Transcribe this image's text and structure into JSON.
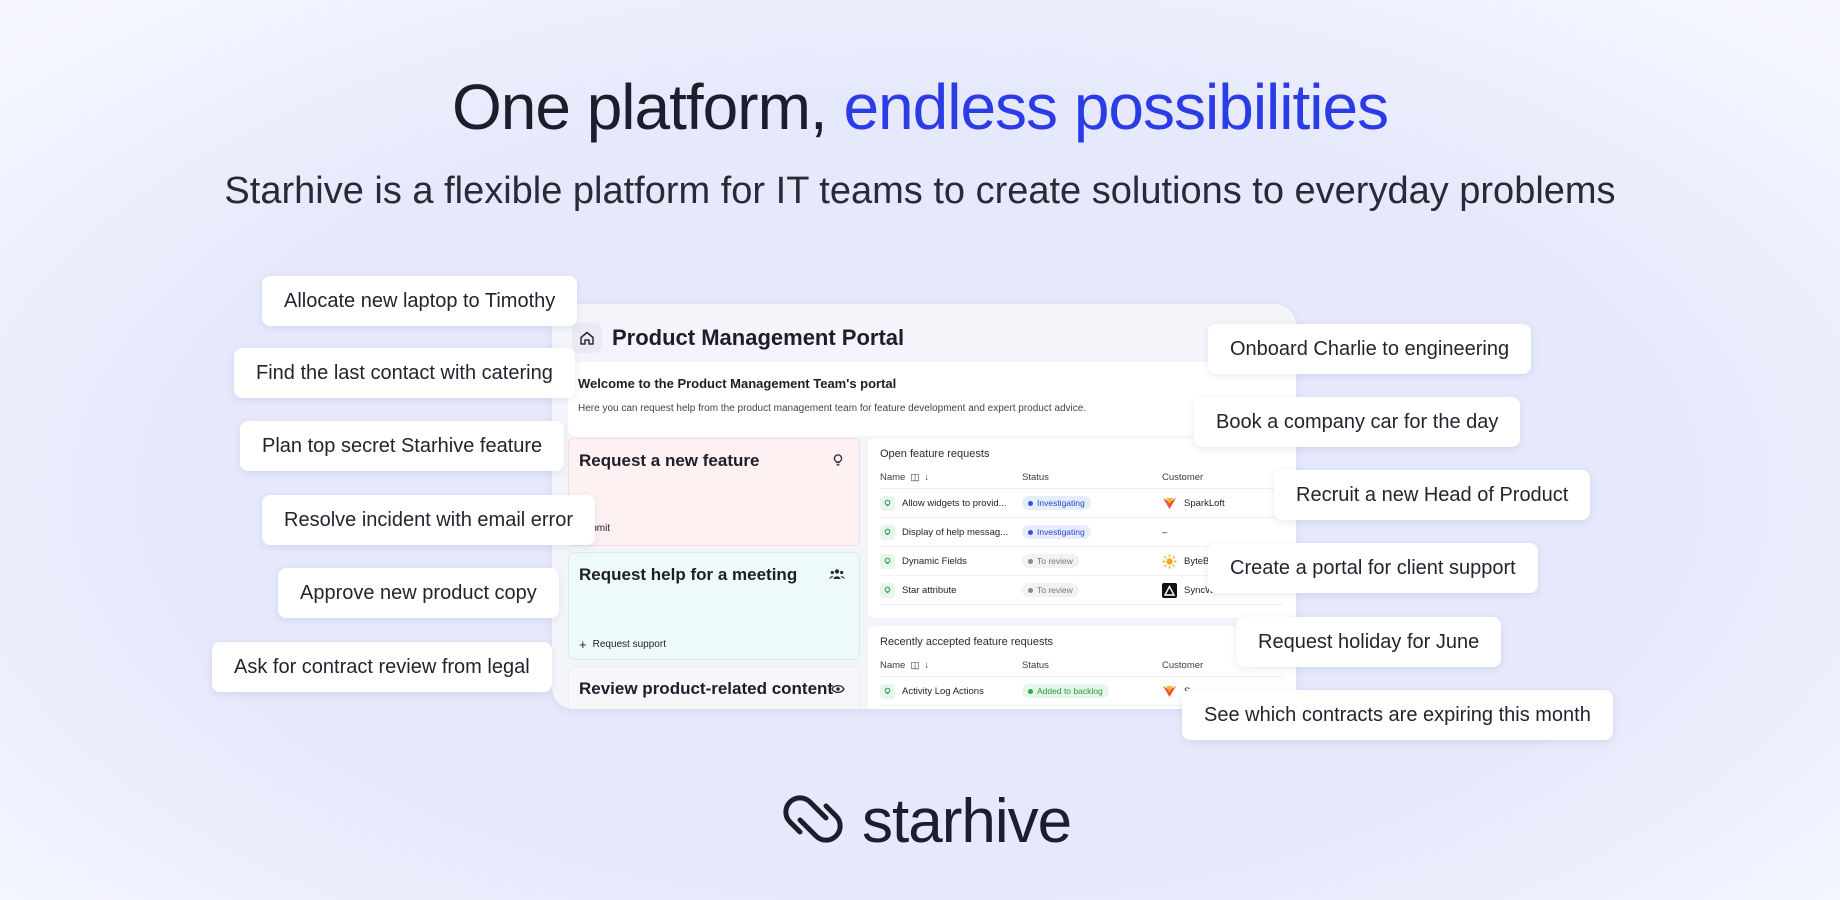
{
  "hero": {
    "title_main": "One platform, ",
    "title_accent": "endless possibilities",
    "subtitle": "Starhive is a flexible platform for IT teams to create solutions to everyday problems"
  },
  "portal": {
    "title": "Product Management Portal",
    "welcome_title": "Welcome to the Product Management Team's portal",
    "welcome_text": "Here you can request help from the product management team for feature development and expert product advice.",
    "request_cards": [
      {
        "title": "Request a new feature",
        "action": "Submit",
        "icon": "lightbulb-icon"
      },
      {
        "title": "Request help for a meeting",
        "action": "Request support",
        "icon": "people-icon"
      },
      {
        "title": "Review product-related content",
        "action": "",
        "icon": "eye-icon"
      }
    ],
    "open_requests": {
      "title": "Open feature requests",
      "headers": {
        "name": "Name",
        "status": "Status",
        "customer": "Customer"
      },
      "rows": [
        {
          "name": "Allow widgets to provid...",
          "status": "Investigating",
          "customer": "SparkLoft"
        },
        {
          "name": "Display of help messag...",
          "status": "Investigating",
          "customer": "–"
        },
        {
          "name": "Dynamic Fields",
          "status": "To review",
          "customer": "ByteBl"
        },
        {
          "name": "Star attribute",
          "status": "To review",
          "customer": "SyncWave"
        }
      ]
    },
    "accepted_requests": {
      "title": "Recently accepted feature requests",
      "headers": {
        "name": "Name",
        "status": "Status",
        "customer": "Customer"
      },
      "rows": [
        {
          "name": "Activity Log Actions",
          "status": "Added to backlog",
          "customer": "S"
        }
      ]
    }
  },
  "pills_left": [
    "Allocate new laptop to Timothy",
    "Find the last contact with catering",
    "Plan top secret Starhive feature",
    "Resolve incident with email error",
    "Approve new product copy",
    "Ask for contract review from legal"
  ],
  "pills_right": [
    "Onboard Charlie to engineering",
    "Book a company car for the day",
    "Recruit a new Head of Product",
    "Create a portal for client support",
    "Request holiday for June",
    "See which contracts are expiring this month"
  ],
  "brand": {
    "name": "starhive"
  },
  "colors": {
    "accent": "#2b3ce6",
    "background": "#e6e9fb"
  }
}
